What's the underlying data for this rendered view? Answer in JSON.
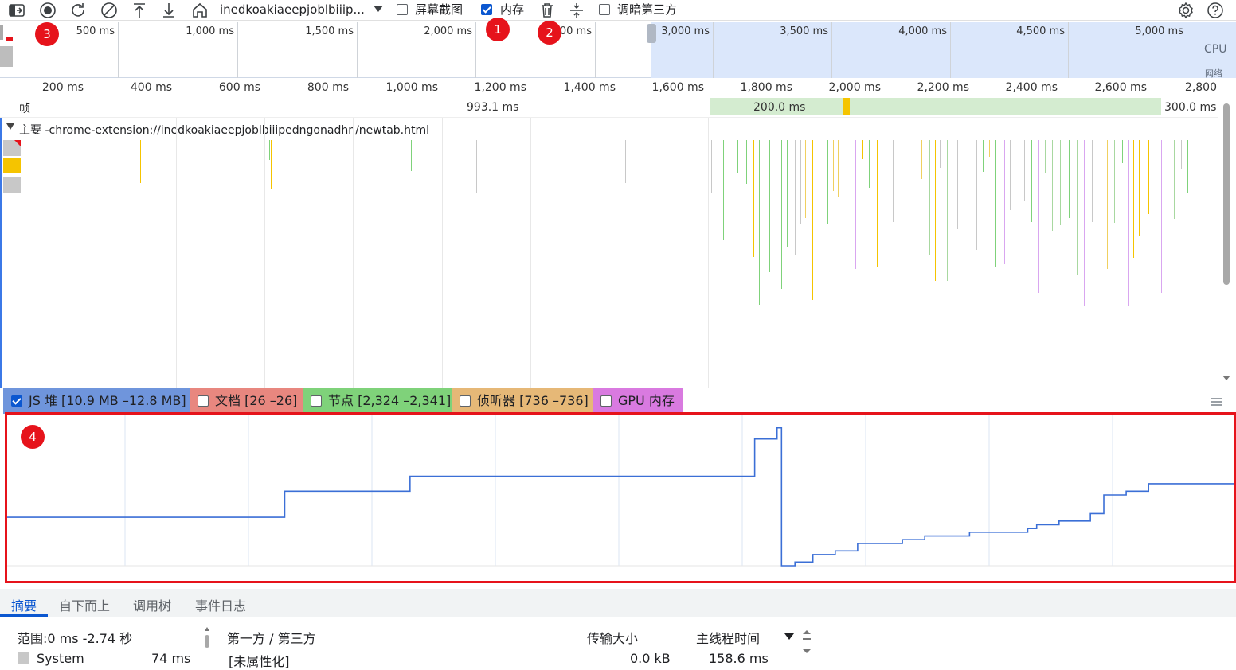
{
  "toolbar": {
    "url_dropdown": "inedkoakiaeepjoblbiiip...",
    "screenshot_label": "屏幕截图",
    "screenshot_checked": false,
    "memory_label": "内存",
    "memory_checked": true,
    "dim_third_party_label": "调暗第三方",
    "dim_third_party_checked": false
  },
  "badges": [
    "1",
    "2",
    "3",
    "4"
  ],
  "overview": {
    "ticks": [
      "500 ms",
      "1,000 ms",
      "1,500 ms",
      "2,000 ms",
      "00 ms",
      "3,000 ms",
      "3,500 ms",
      "4,000 ms",
      "4,500 ms",
      "5,000 ms"
    ],
    "cpu_label": "CPU",
    "net_label": "网络"
  },
  "ruler": {
    "ticks": [
      "200 ms",
      "400 ms",
      "600 ms",
      "800 ms",
      "1,000 ms",
      "1,200 ms",
      "1,400 ms",
      "1,600 ms",
      "1,800 ms",
      "2,000 ms",
      "2,200 ms",
      "2,400 ms",
      "2,600 ms",
      "2,800"
    ]
  },
  "frames": {
    "label": "帧",
    "durations": [
      "993.1 ms",
      "200.0 ms",
      "300.0 ms"
    ]
  },
  "main_track": {
    "title": "主要 -chrome-extension://inedkoakiaeepjoblbiiipedngonadhn/newtab.html"
  },
  "legend": [
    {
      "label": "JS 堆 [10.9 MB –12.8 MB]",
      "checked": true,
      "color": "#4f80d8"
    },
    {
      "label": "文档 [26 –26]",
      "checked": false,
      "color": "#e88a83"
    },
    {
      "label": "节点 [2,324 –2,341]",
      "checked": false,
      "color": "#7fd27a"
    },
    {
      "label": "侦听器 [736 –736]",
      "checked": false,
      "color": "#e6b877"
    },
    {
      "label": "GPU 内存",
      "checked": false,
      "color": "#d97ae0"
    }
  ],
  "tabs": [
    "摘要",
    "自下而上",
    "调用树",
    "事件日志"
  ],
  "summary": {
    "range": "范围:0 ms -2.74 秒",
    "system_label": "System",
    "system_value": "74 ms",
    "col_party": "第一方 / 第三方",
    "col_transfer": "传输大小",
    "col_main_time": "主线程时间",
    "row_label": "[未属性化]",
    "row_transfer": "0.0 kB",
    "row_time": "158.6 ms"
  },
  "chart_data": {
    "type": "line",
    "title": "",
    "series": [
      {
        "name": "JS 堆",
        "values_mb": [
          11.55,
          11.55,
          11.55,
          11.55,
          11.9,
          11.9,
          12.1,
          12.1,
          12.1,
          12.1,
          12.1,
          12.1,
          12.1,
          12.6,
          12.6,
          12.75,
          10.9,
          10.95,
          11.05,
          11.1,
          11.2,
          11.25,
          11.3,
          11.3,
          11.35,
          11.35,
          11.35,
          11.4,
          11.45,
          11.5,
          11.6,
          11.85,
          11.9,
          12.0,
          12.0
        ]
      }
    ],
    "x": [
      "0",
      "0.25",
      "0.5",
      "0.6",
      "0.62",
      "0.75",
      "0.9",
      "0.95",
      "1.1",
      "1.25",
      "1.4",
      "1.55",
      "1.65",
      "1.67",
      "1.68",
      "1.72",
      "1.73",
      "1.76",
      "1.8",
      "1.85",
      "1.9",
      "2.0",
      "2.05",
      "2.1",
      "2.15",
      "2.2",
      "2.25",
      "2.28",
      "2.3",
      "2.35",
      "2.42",
      "2.45",
      "2.5",
      "2.55",
      "2.74"
    ],
    "ylim": [
      10.9,
      12.8
    ]
  }
}
